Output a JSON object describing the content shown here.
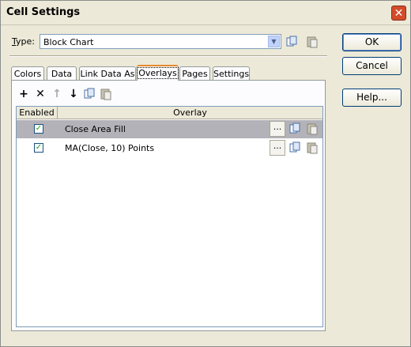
{
  "window": {
    "title": "Cell Settings",
    "close_glyph": "✕"
  },
  "type": {
    "label_prefix": "",
    "label_underlined": "T",
    "label_rest": "ype:",
    "value": "Block Chart",
    "dropdown_glyph": "▼"
  },
  "side_buttons": {
    "ok": "OK",
    "cancel": "Cancel",
    "help": "Help..."
  },
  "tabs": [
    "Colors",
    "Data",
    "Link Data As",
    "Overlays",
    "Pages",
    "Settings"
  ],
  "active_tab": "Overlays",
  "toolbar": {
    "add": "+",
    "delete": "✕",
    "up": "↑",
    "down": "↓"
  },
  "grid": {
    "headers": {
      "enabled": "Enabled",
      "overlay": "Overlay"
    },
    "rows": [
      {
        "enabled": true,
        "overlay": "Close Area Fill",
        "selected": true,
        "dots": "..."
      },
      {
        "enabled": true,
        "overlay": "MA(Close, 10) Points",
        "selected": false,
        "dots": "..."
      }
    ],
    "check_glyph": "✓"
  },
  "colors": {
    "accent": "#e68b2c",
    "close": "#d24b2b",
    "selection": "#b3b2b8"
  }
}
